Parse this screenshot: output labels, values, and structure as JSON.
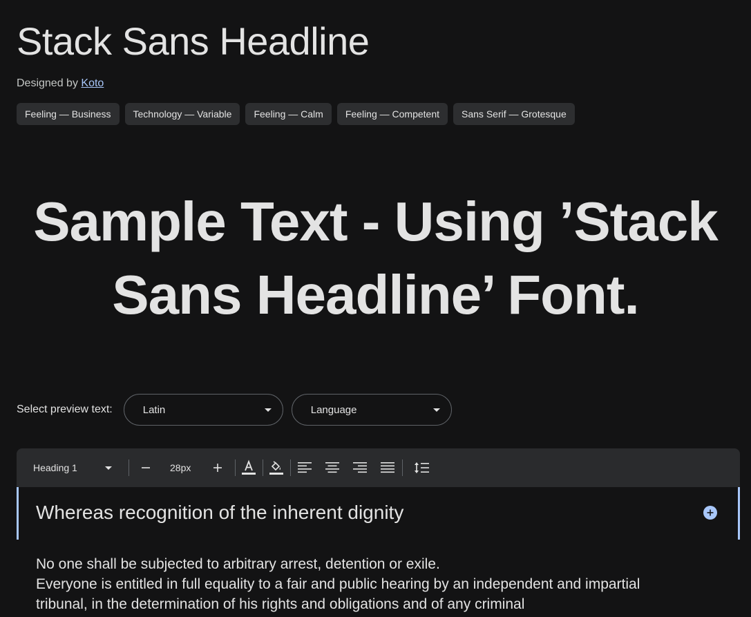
{
  "font": {
    "title": "Stack Sans Headline",
    "designed_by_prefix": "Designed by",
    "designer": "Koto"
  },
  "tags": [
    "Feeling — Business",
    "Technology — Variable",
    "Feeling — Calm",
    "Feeling — Competent",
    "Sans Serif — Grotesque"
  ],
  "sample": {
    "line1": "Sample Text - Using ’Stack",
    "line2": "Sans Headline’ Font."
  },
  "preview": {
    "label": "Select preview text:",
    "script_value": "Latin",
    "language_value": "Language"
  },
  "toolbar": {
    "style_value": "Heading 1",
    "font_size": "28px",
    "icons": [
      "minus-icon",
      "plus-icon",
      "text-color-icon",
      "fill-color-icon",
      "align-left-icon",
      "align-center-icon",
      "align-right-icon",
      "align-justify-icon",
      "line-spacing-icon"
    ]
  },
  "editor": {
    "heading": "Whereas recognition of the inherent dignity",
    "paragraphs": [
      "No one shall be subjected to arbitrary arrest, detention or exile.",
      "Everyone is entitled in full equality to a fair and public hearing by an independent and impartial tribunal, in the determination of his rights and obligations and of any criminal"
    ]
  },
  "colors": {
    "background": "#131314",
    "text": "#e3e3e3",
    "accent": "#a8c7fa",
    "chip": "#2d2e30",
    "toolbar": "#2a2b2d"
  }
}
